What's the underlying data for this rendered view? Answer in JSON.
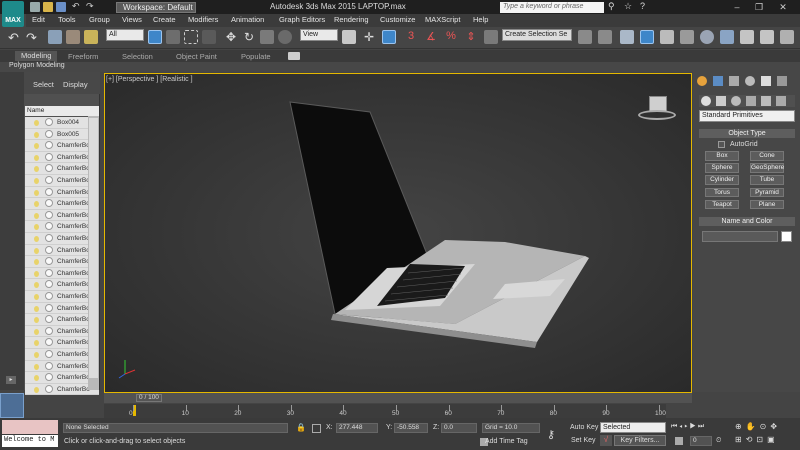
{
  "app": {
    "badge": "MAX",
    "workspace_label": "Workspace: Default",
    "title": "Autodesk 3ds Max  2015     LAPTOP.max",
    "search_placeholder": "Type a keyword or phrase"
  },
  "menus": [
    "Edit",
    "Tools",
    "Group",
    "Views",
    "Create",
    "Modifiers",
    "Animation",
    "Graph Editors",
    "Rendering",
    "Customize",
    "MAXScript",
    "Help"
  ],
  "toolbar": {
    "filter_value": "All",
    "ref_coord": "View",
    "selection_set_placeholder": "Create Selection Se"
  },
  "ribbon": {
    "tabs": [
      "Modeling",
      "Freeform",
      "Selection",
      "Object Paint",
      "Populate"
    ],
    "active_tab": "Modeling",
    "subtitle": "Polygon Modeling"
  },
  "scene_explorer": {
    "tabs": [
      "Select",
      "Display"
    ],
    "column": "Name",
    "rows": [
      "Box004",
      "Box005",
      "ChamferBo",
      "ChamferBo",
      "ChamferBo",
      "ChamferBo",
      "ChamferBo",
      "ChamferBo",
      "ChamferBo",
      "ChamferBo",
      "ChamferBo",
      "ChamferBo",
      "ChamferBo",
      "ChamferBo",
      "ChamferBo",
      "ChamferBo",
      "ChamferBo",
      "ChamferBo",
      "ChamferBo",
      "ChamferBo",
      "ChamferBo",
      "ChamferBo",
      "ChamferBo",
      "ChamferBo"
    ]
  },
  "viewport": {
    "label": "[+] [Perspective ] [Realistic ]"
  },
  "command_panel": {
    "category": "Standard Primitives",
    "object_type_title": "Object Type",
    "autogrid": "AutoGrid",
    "buttons": [
      "Box",
      "Cone",
      "Sphere",
      "GeoSphere",
      "Cylinder",
      "Tube",
      "Torus",
      "Pyramid",
      "Teapot",
      "Plane"
    ],
    "name_color_title": "Name and Color",
    "name_value": ""
  },
  "timeline": {
    "frame": "0 / 100",
    "ticks": [
      "0",
      "10",
      "20",
      "30",
      "40",
      "50",
      "60",
      "70",
      "80",
      "90",
      "100"
    ]
  },
  "status": {
    "listener": "Welcome to M",
    "selection": "None Selected",
    "prompt": "Click or click-and-drag to select objects",
    "x_label": "X:",
    "x_value": "277.448",
    "y_label": "Y:",
    "y_value": "-50.558",
    "z_label": "Z:",
    "z_value": "0.0",
    "grid": "Grid = 10.0",
    "add_time_tag": "Add Time Tag",
    "auto_key": "Auto Key",
    "key_mode": "Selected",
    "set_key": "Set Key",
    "key_filters": "Key Filters...",
    "frame_value": "0"
  },
  "colors": {
    "viewport_border": "#e5b800",
    "accent": "#3e86c9"
  }
}
